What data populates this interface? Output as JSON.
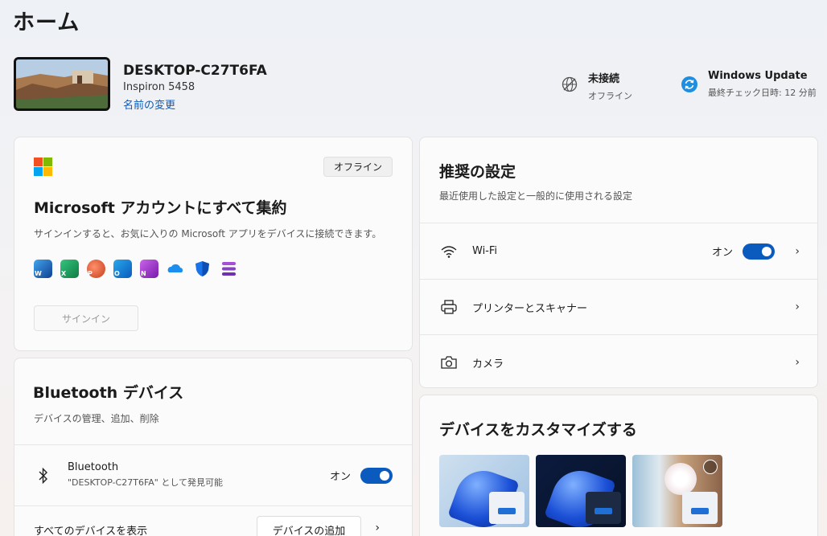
{
  "page": {
    "title": "ホーム"
  },
  "device": {
    "name": "DESKTOP-C27T6FA",
    "model": "Inspiron 5458",
    "rename": "名前の変更"
  },
  "network": {
    "title": "未接続",
    "subtitle": "オフライン",
    "icon": "globe-icon"
  },
  "update": {
    "title": "Windows Update",
    "subtitle": "最終チェック日時: 12 分前",
    "icon": "sync-icon"
  },
  "account_card": {
    "badge": "オフライン",
    "heading": "Microsoft アカウントにすべて集約",
    "description": "サインインすると、お気に入りの Microsoft アプリをデバイスに接続できます。",
    "signin_label": "サインイン",
    "apps": [
      "word-icon",
      "excel-icon",
      "powerpoint-icon",
      "outlook-icon",
      "onenote-icon",
      "onedrive-icon",
      "defender-icon",
      "clipchamp-icon"
    ]
  },
  "bluetooth_card": {
    "heading": "Bluetooth デバイス",
    "description": "デバイスの管理、追加、削除",
    "bt_title": "Bluetooth",
    "bt_subtitle": "\"DESKTOP-C27T6FA\" として発見可能",
    "bt_state": "オン",
    "view_all": "すべてのデバイスを表示",
    "add_device": "デバイスの追加"
  },
  "recommended_card": {
    "heading": "推奨の設定",
    "description": "最近使用した設定と一般的に使用される設定",
    "items": [
      {
        "label": "Wi-Fi",
        "state": "オン",
        "icon": "wifi-icon"
      },
      {
        "label": "プリンターとスキャナー",
        "icon": "printer-icon"
      },
      {
        "label": "カメラ",
        "icon": "camera-icon"
      }
    ]
  },
  "customize_card": {
    "heading": "デバイスをカスタマイズする"
  },
  "colors": {
    "accent": "#0a5bbd",
    "link": "#0a5bbd"
  }
}
